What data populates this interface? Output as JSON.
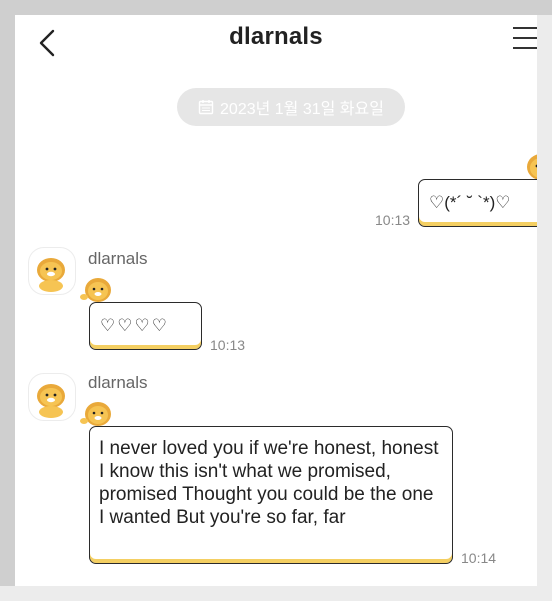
{
  "header": {
    "title": "dlarnals"
  },
  "date_separator": {
    "label": "2023년 1월 31일 화요일"
  },
  "messages": [
    {
      "direction": "outgoing",
      "text": "♡(*´ ˘ `*)♡",
      "time": "10:13"
    },
    {
      "direction": "incoming",
      "sender": "dlarnals",
      "text": "♡♡♡♡",
      "time": "10:13"
    },
    {
      "direction": "incoming",
      "sender": "dlarnals",
      "text": "I never loved you if we're honest, honest I know this isn't what we promised, promised Thought you could be the one I wanted But you're so far, far",
      "time": "10:14"
    }
  ],
  "icons": [
    "chevron-left-icon",
    "hamburger-menu-icon",
    "calendar-icon"
  ],
  "colors": {
    "bubble_accent": "#f4cf62",
    "bubble_border": "#2b2b2b",
    "date_pill_bg": "#e6e6e6",
    "background": "#ffffff",
    "frame": "#cfcfcf"
  }
}
